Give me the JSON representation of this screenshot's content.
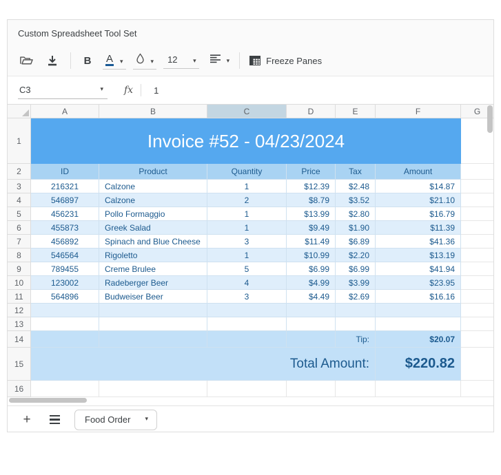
{
  "app": {
    "title": "Custom Spreadsheet Tool Set"
  },
  "toolbar": {
    "bold_label": "B",
    "font_color_label": "A",
    "font_size": "12",
    "freeze_label": "Freeze Panes",
    "icons": [
      "folder-open-icon",
      "import-download-icon",
      "fill-color-droplet-icon",
      "align-left-icon",
      "freeze-grid-icon"
    ]
  },
  "glyphs": {
    "caret": "▾",
    "plus": "+"
  },
  "formula_bar": {
    "cell_ref": "C3",
    "fx_label": "fx",
    "value": "1"
  },
  "sheet": {
    "selected_cell": "C3",
    "selected_column": "C",
    "columns": [
      "A",
      "B",
      "C",
      "D",
      "E",
      "F",
      "G"
    ],
    "rows": [
      {
        "n": 1,
        "type": "title",
        "text": "Invoice #52 - 04/23/2024"
      },
      {
        "n": 2,
        "type": "header",
        "cells": [
          "ID",
          "Product",
          "Quantity",
          "Price",
          "Tax",
          "Amount"
        ]
      },
      {
        "n": 3,
        "type": "data",
        "band": false,
        "cells": [
          "216321",
          "Calzone",
          "1",
          "$12.39",
          "$2.48",
          "$14.87"
        ]
      },
      {
        "n": 4,
        "type": "data",
        "band": true,
        "cells": [
          "546897",
          "Calzone",
          "2",
          "$8.79",
          "$3.52",
          "$21.10"
        ]
      },
      {
        "n": 5,
        "type": "data",
        "band": false,
        "cells": [
          "456231",
          "Pollo Formaggio",
          "1",
          "$13.99",
          "$2.80",
          "$16.79"
        ]
      },
      {
        "n": 6,
        "type": "data",
        "band": true,
        "cells": [
          "455873",
          "Greek Salad",
          "1",
          "$9.49",
          "$1.90",
          "$11.39"
        ]
      },
      {
        "n": 7,
        "type": "data",
        "band": false,
        "cells": [
          "456892",
          "Spinach and Blue Cheese",
          "3",
          "$11.49",
          "$6.89",
          "$41.36"
        ]
      },
      {
        "n": 8,
        "type": "data",
        "band": true,
        "cells": [
          "546564",
          "Rigoletto",
          "1",
          "$10.99",
          "$2.20",
          "$13.19"
        ]
      },
      {
        "n": 9,
        "type": "data",
        "band": false,
        "cells": [
          "789455",
          "Creme Brulee",
          "5",
          "$6.99",
          "$6.99",
          "$41.94"
        ]
      },
      {
        "n": 10,
        "type": "data",
        "band": true,
        "cells": [
          "123002",
          "Radeberger Beer",
          "4",
          "$4.99",
          "$3.99",
          "$23.95"
        ]
      },
      {
        "n": 11,
        "type": "data",
        "band": false,
        "cells": [
          "564896",
          "Budweiser Beer",
          "3",
          "$4.49",
          "$2.69",
          "$16.16"
        ]
      },
      {
        "n": 12,
        "type": "empty",
        "band": true
      },
      {
        "n": 13,
        "type": "empty",
        "band": false
      },
      {
        "n": 14,
        "type": "tip",
        "label": "Tip:",
        "value": "$20.07"
      },
      {
        "n": 15,
        "type": "total",
        "label": "Total Amount:",
        "value": "$220.82"
      },
      {
        "n": 16,
        "type": "trailing"
      }
    ]
  },
  "sheet_tabs": {
    "active_label": "Food Order"
  },
  "colors": {
    "title_fill": "#55a8ef",
    "header_fill": "#a9d3f3",
    "band_fill": "#dfeefb",
    "summary_fill": "#c2e0f8",
    "ink_blue": "#1c5a8e",
    "font_color_indicator": "#1a5a96"
  }
}
